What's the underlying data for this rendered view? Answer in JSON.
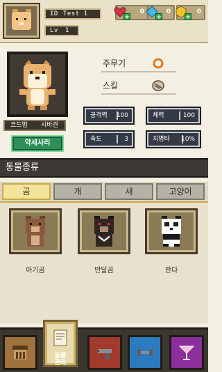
{
  "header": {
    "id_label": "ID",
    "id_value": "Test 1",
    "lv_label": "Lv",
    "lv_value": "1",
    "resources": [
      {
        "name": "heart",
        "value": "0",
        "color": "#d9334a"
      },
      {
        "name": "diamond",
        "value": "0",
        "color": "#49b6ea"
      },
      {
        "name": "gold",
        "value": "0",
        "color": "#f2c12e"
      }
    ]
  },
  "character": {
    "nick": "코드멍",
    "breed": "시바견",
    "detail_button": "악세사리"
  },
  "equipment": {
    "weapon_label": "주무기",
    "skill_label": "스킬"
  },
  "stats": [
    {
      "key": "공격력",
      "value": "100"
    },
    {
      "key": "체력",
      "value": "100"
    },
    {
      "key": "속도",
      "value": "3"
    },
    {
      "key": "치명타",
      "value": "10%"
    }
  ],
  "section_title": "동물종류",
  "tabs": [
    "곰",
    "개",
    "새",
    "고양이"
  ],
  "active_tab": "곰",
  "animals": [
    {
      "name": "아기곰",
      "color": "#8a5a3a"
    },
    {
      "name": "반달곰",
      "color": "#2f2622"
    },
    {
      "name": "판다",
      "color": "#ffffff"
    }
  ],
  "nav": {
    "active_label": "동물\n관리",
    "active_label_line1": "동물",
    "active_label_line2": "관리"
  }
}
